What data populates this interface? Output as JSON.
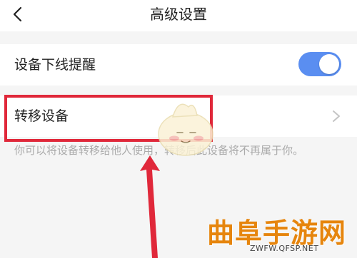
{
  "header": {
    "title": "高级设置"
  },
  "settings": {
    "offline_alert_label": "设备下线提醒",
    "offline_alert_enabled": true,
    "transfer_device_label": "转移设备",
    "transfer_hint": "你可以将设备转移给他人使用，转移后此设备将不再属于你。"
  },
  "watermark": {
    "brand": "曲阜手游网",
    "url": "ZWFW.QFSP.NET"
  },
  "colors": {
    "accent": "#5a8ef1",
    "highlight": "#e0283a",
    "watermark": "#e6850d"
  },
  "icons": {
    "back": "chevron-left-icon",
    "transfer": "chevron-right-icon"
  }
}
